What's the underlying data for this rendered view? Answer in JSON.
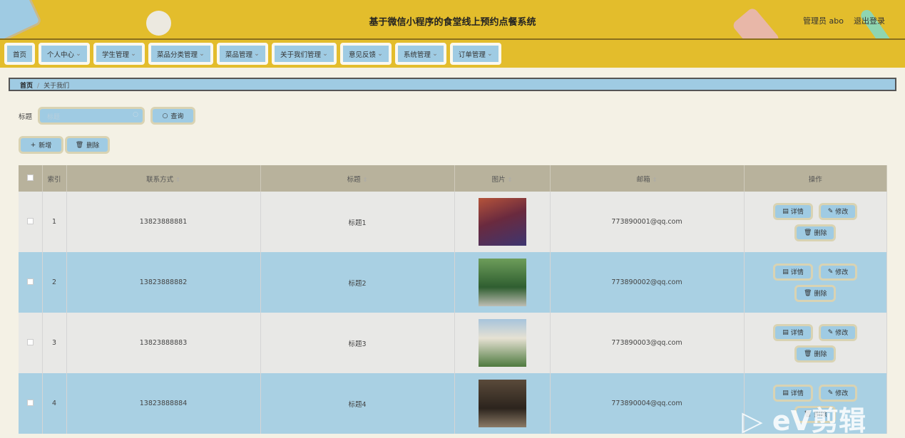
{
  "header": {
    "title": "基于微信小程序的食堂线上预约点餐系统",
    "user": "管理员 abo",
    "logout": "退出登录"
  },
  "nav": [
    {
      "label": "首页",
      "dropdown": false
    },
    {
      "label": "个人中心",
      "dropdown": true
    },
    {
      "label": "学生管理",
      "dropdown": true
    },
    {
      "label": "菜品分类管理",
      "dropdown": true
    },
    {
      "label": "菜品管理",
      "dropdown": true
    },
    {
      "label": "关于我们管理",
      "dropdown": true
    },
    {
      "label": "意见反馈",
      "dropdown": true
    },
    {
      "label": "系统管理",
      "dropdown": true
    },
    {
      "label": "订单管理",
      "dropdown": true
    }
  ],
  "breadcrumb": {
    "home": "首页",
    "sep": "/",
    "current": "关于我们"
  },
  "search": {
    "label": "标题",
    "placeholder": "标题",
    "query": "查询"
  },
  "actions": {
    "add": "新增",
    "delete": "删除"
  },
  "table": {
    "headers": {
      "index": "索引",
      "contact": "联系方式",
      "title": "标题",
      "image": "图片",
      "email": "邮箱",
      "ops": "操作"
    },
    "ops": {
      "detail": "详情",
      "edit": "修改",
      "delete": "删除"
    },
    "rows": [
      {
        "index": "1",
        "contact": "13823888881",
        "title": "标题1",
        "email": "773890001@qq.com"
      },
      {
        "index": "2",
        "contact": "13823888882",
        "title": "标题2",
        "email": "773890002@qq.com"
      },
      {
        "index": "3",
        "contact": "13823888883",
        "title": "标题3",
        "email": "773890003@qq.com"
      },
      {
        "index": "4",
        "contact": "13823888884",
        "title": "标题4",
        "email": "773890004@qq.com"
      }
    ]
  },
  "watermark": "eV剪辑"
}
